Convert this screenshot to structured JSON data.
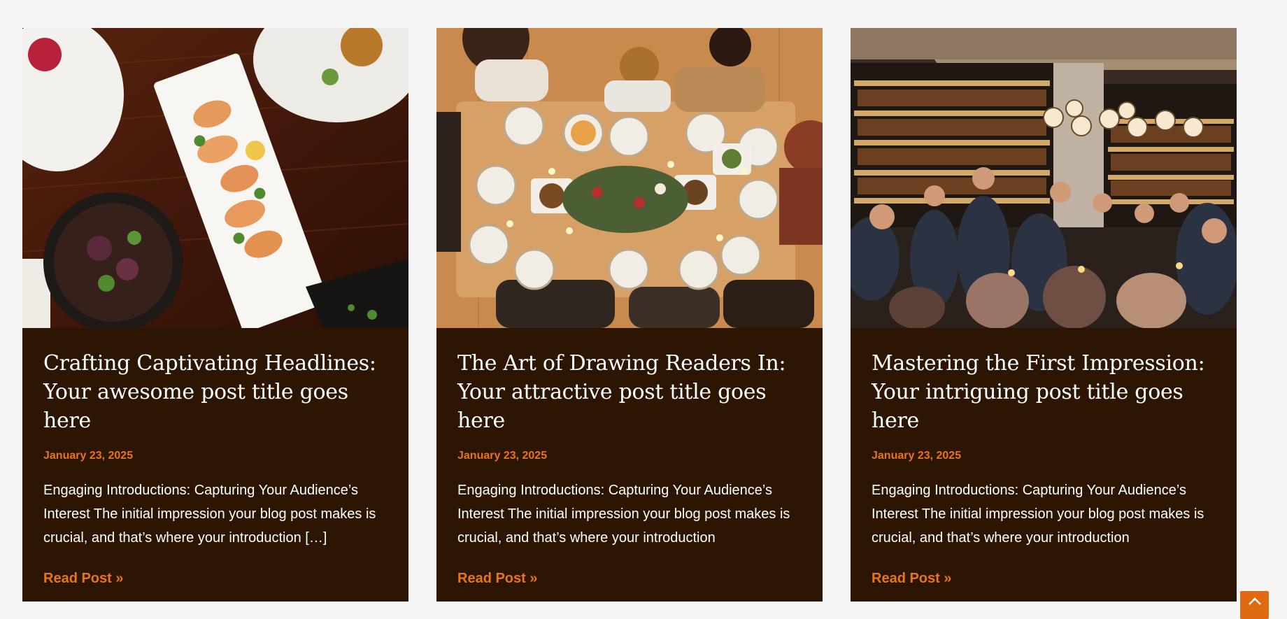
{
  "posts": [
    {
      "title_line1": "Crafting Captivating Headlines:",
      "title_line2": "Your awesome post title goes here",
      "date": "January 23, 2025",
      "excerpt": "Engaging Introductions: Capturing Your Audience’s Interest The initial impression your blog post makes is crucial, and that’s where your introduction […]",
      "read_more": "Read Post »"
    },
    {
      "title_line1": "The Art of Drawing Readers In:",
      "title_line2": "Your attractive post title goes here",
      "date": "January 23, 2025",
      "excerpt": "Engaging Introductions: Capturing Your Audience’s Interest The initial impression your blog post makes is crucial, and that’s where your introduction",
      "read_more": "Read Post »"
    },
    {
      "title_line1": "Mastering the First Impression:",
      "title_line2": "Your intriguing post title goes here",
      "date": "January 23, 2025",
      "excerpt": "Engaging Introductions: Capturing Your Audience’s Interest The initial impression your blog post makes is crucial, and that’s where your introduction",
      "read_more": "Read Post »"
    }
  ],
  "colors": {
    "page_bg": "#f4f4f4",
    "card_bg": "#2c1603",
    "accent": "#e8751a",
    "title_text": "#ffffff"
  },
  "icons": {
    "scroll_top": "chevron-up-icon"
  }
}
